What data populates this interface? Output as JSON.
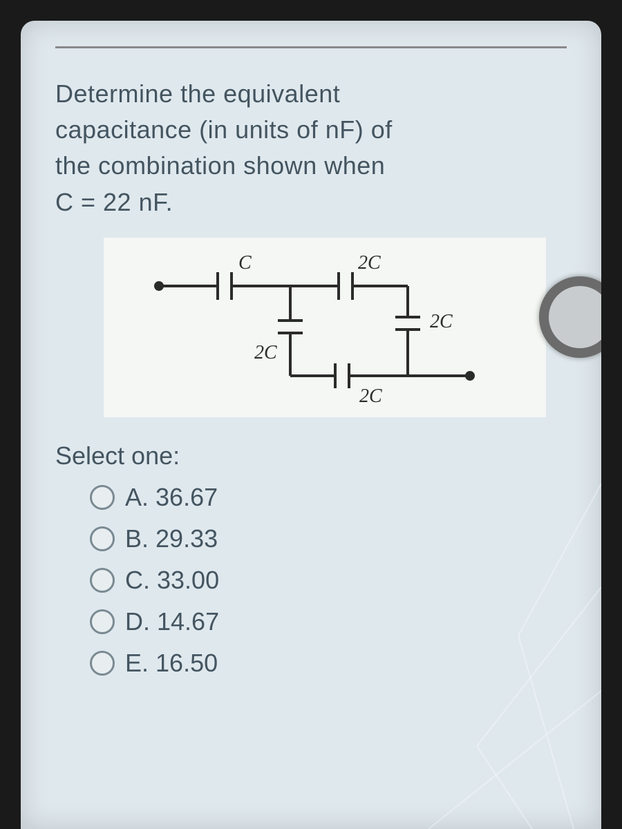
{
  "question": {
    "line1": "Determine the equivalent",
    "line2": "capacitance (in units of nF) of",
    "line3": "the combination shown when",
    "line4": "C = 22 nF."
  },
  "diagram": {
    "labels": {
      "top_left": "C",
      "top_right": "2C",
      "mid_left": "2C",
      "right": "2C",
      "bottom": "2C"
    }
  },
  "select_label": "Select one:",
  "options": [
    {
      "letter": "A",
      "value": "36.67"
    },
    {
      "letter": "B",
      "value": "29.33"
    },
    {
      "letter": "C",
      "value": "33.00"
    },
    {
      "letter": "D",
      "value": "14.67"
    },
    {
      "letter": "E",
      "value": "16.50"
    }
  ]
}
